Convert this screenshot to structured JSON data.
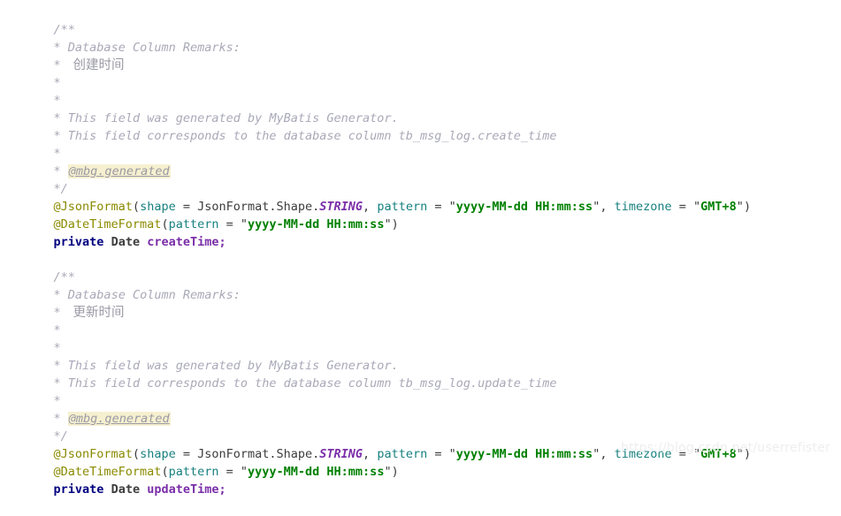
{
  "editor": {
    "background_color": "#ffffff",
    "language": "java",
    "colors": {
      "comment": "#a9a9b8",
      "annotation": "#8a8a00",
      "parameter": "#17807f",
      "string": "#008000",
      "constant": "#7a2ea8",
      "keyword": "#000080",
      "field": "#7a2ea8",
      "javadoc_tag_highlight": "#f6f0cf"
    }
  },
  "code_blocks": [
    {
      "name": "create-time-field",
      "javadoc": {
        "open": "/**",
        "remarks_label": "Database Column Remarks:",
        "remarks_value": "创建时间",
        "generated_by": "This field was generated by MyBatis Generator.",
        "corresponds_to": "This field corresponds to the database column tb_msg_log.create_time",
        "tag": "@mbg.generated",
        "close": "*/"
      },
      "annotations": [
        {
          "name": "@JsonFormat",
          "args": [
            {
              "key": "shape",
              "value": "JsonFormat.Shape.STRING",
              "kind": "constant"
            },
            {
              "key": "pattern",
              "value": "yyyy-MM-dd HH:mm:ss",
              "kind": "string"
            },
            {
              "key": "timezone",
              "value": "GMT+8",
              "kind": "string"
            }
          ]
        },
        {
          "name": "@DateTimeFormat",
          "args": [
            {
              "key": "pattern",
              "value": "yyyy-MM-dd HH:mm:ss",
              "kind": "string"
            }
          ]
        }
      ],
      "declaration": {
        "modifier": "private",
        "type": "Date",
        "field": "createTime",
        "terminator": ";"
      }
    },
    {
      "name": "update-time-field",
      "javadoc": {
        "open": "/**",
        "remarks_label": "Database Column Remarks:",
        "remarks_value": "更新时间",
        "generated_by": "This field was generated by MyBatis Generator.",
        "corresponds_to": "This field corresponds to the database column tb_msg_log.update_time",
        "tag": "@mbg.generated",
        "close": "*/"
      },
      "annotations": [
        {
          "name": "@JsonFormat",
          "args": [
            {
              "key": "shape",
              "value": "JsonFormat.Shape.STRING",
              "kind": "constant"
            },
            {
              "key": "pattern",
              "value": "yyyy-MM-dd HH:mm:ss",
              "kind": "string"
            },
            {
              "key": "timezone",
              "value": "GMT+8",
              "kind": "string"
            }
          ]
        },
        {
          "name": "@DateTimeFormat",
          "args": [
            {
              "key": "pattern",
              "value": "yyyy-MM-dd HH:mm:ss",
              "kind": "string"
            }
          ]
        }
      ],
      "declaration": {
        "modifier": "private",
        "type": "Date",
        "field": "updateTime",
        "terminator": ";"
      }
    }
  ],
  "tokens": {
    "star": "*",
    "star_bullet": "*",
    "equals": " = ",
    "comma": ", ",
    "paren_open": "(",
    "paren_close": ")",
    "quote": "\"",
    "dot_shape": "JsonFormat.Shape.",
    "shape_const": "STRING",
    "key_shape": "shape",
    "key_pattern": "pattern",
    "key_timezone": "timezone"
  },
  "watermark": {
    "text": "https://blog.csdn.net/userrefister"
  }
}
